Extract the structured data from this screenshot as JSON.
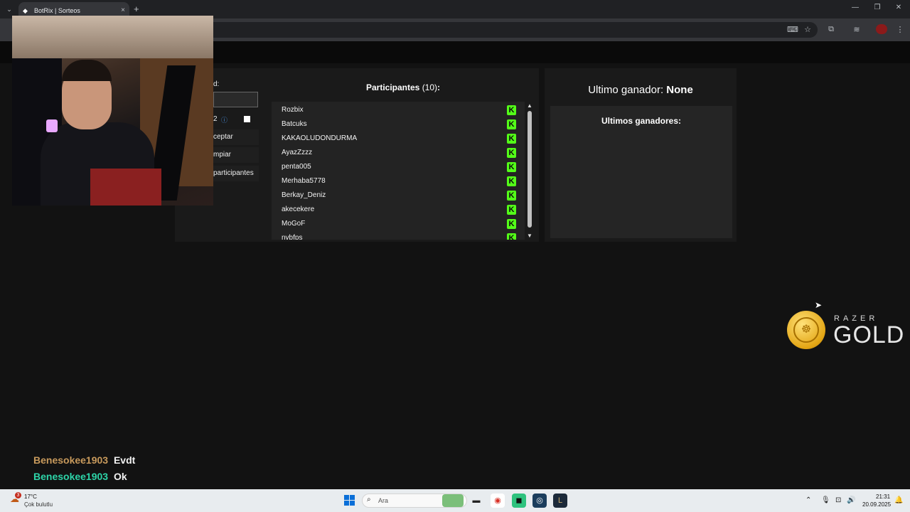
{
  "browser": {
    "tab_title": "BotRix | Sorteos",
    "tab_favicon": "diamond-icon",
    "new_tab": "+",
    "tab_close": "×",
    "tab_menu": "⌄",
    "minimize": "—",
    "maximize": "❐",
    "close": "✕",
    "toolbar_icons": [
      "translate-icon",
      "star-icon",
      "extensions-icon",
      "media-icon",
      "profile-icon",
      "menu-icon"
    ]
  },
  "settings": {
    "field_label": "d:",
    "value_text": "2",
    "info_glyph": "ⓘ",
    "accept_label": "ceptar",
    "clear_label": "mpiar",
    "participants_label": "participantes"
  },
  "participants": {
    "title": "Participantes",
    "count": "(10)",
    "colon": ":",
    "items": [
      {
        "name": "Rozbix"
      },
      {
        "name": "Batcuks"
      },
      {
        "name": "KAKAOLUDONDURMA"
      },
      {
        "name": "AyazZzzz"
      },
      {
        "name": "penta005"
      },
      {
        "name": "Merhaba5778"
      },
      {
        "name": "Berkay_Deniz"
      },
      {
        "name": "akecekere"
      },
      {
        "name": "MoGoF"
      },
      {
        "name": "nvbfps"
      }
    ],
    "platform_glyph": "K",
    "platform_color": "#53fc18"
  },
  "winner": {
    "label": "Ultimo ganador:",
    "value": "None",
    "recent_title": "Ultimos ganadores:"
  },
  "sponsor": {
    "brand": "RAZER",
    "product": "GOLD"
  },
  "chat": [
    {
      "user": "Benesokee1903",
      "message": "Evdt",
      "user_color": "#c89a5c"
    },
    {
      "user": "Benesokee1903",
      "message": "Ok",
      "user_color": "#2dd4a8"
    }
  ],
  "taskbar": {
    "weather_temp": "17°C",
    "weather_desc": "Çok bulutlu",
    "weather_badge": "3",
    "search_placeholder": "Ara",
    "time": "21:31",
    "date": "20.09.2025"
  }
}
